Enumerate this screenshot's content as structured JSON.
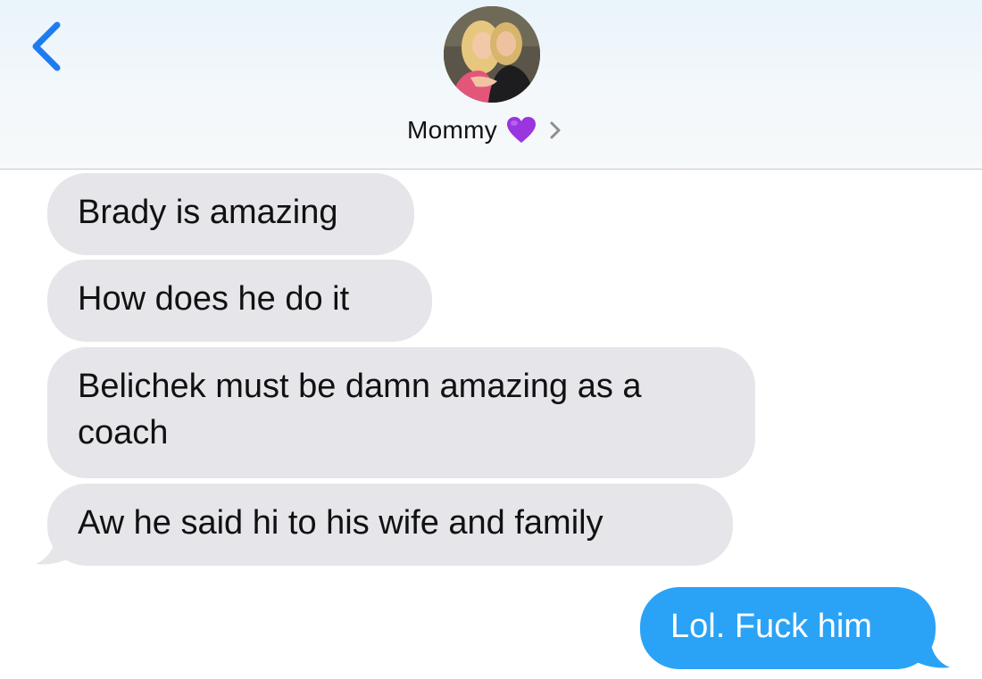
{
  "header": {
    "contact_name": "Mommy",
    "back_icon": "chevron-left-icon",
    "heart_icon": "purple-heart-emoji",
    "detail_icon": "chevron-right-icon",
    "accent_color": "#1f7cf0",
    "heart_color": "#9b35e0"
  },
  "messages": [
    {
      "direction": "incoming",
      "text": "Brady is amazing"
    },
    {
      "direction": "incoming",
      "text": "How does he do it"
    },
    {
      "direction": "incoming",
      "text": "Belichek must be damn amazing as a coach"
    },
    {
      "direction": "incoming",
      "text": "Aw he said hi to his wife and family"
    },
    {
      "direction": "outgoing",
      "text": "Lol. Fuck him"
    }
  ],
  "colors": {
    "incoming_bubble": "#e5e5ea",
    "outgoing_bubble": "#2aa3f6",
    "outgoing_text": "#ffffff"
  }
}
